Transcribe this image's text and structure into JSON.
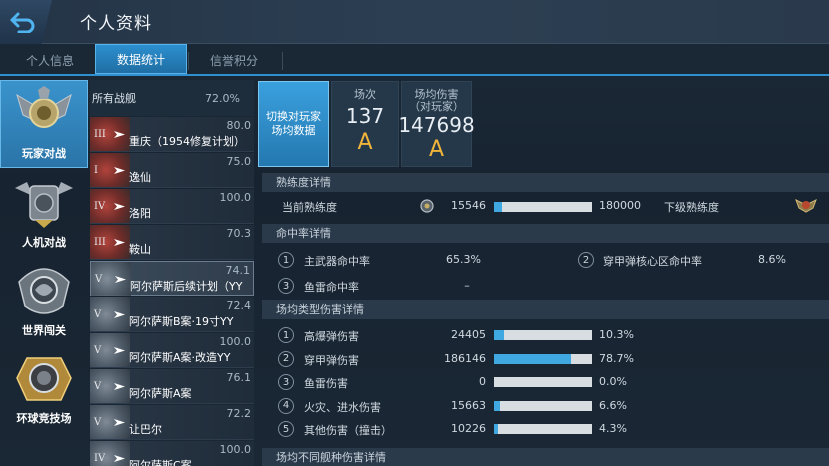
{
  "header": {
    "title": "个人资料"
  },
  "tabs": [
    "个人信息",
    "数据统计",
    "信誉积分"
  ],
  "modes": [
    {
      "label": "玩家对战"
    },
    {
      "label": "人机对战"
    },
    {
      "label": "世界闯关"
    },
    {
      "label": "环球竞技场"
    }
  ],
  "ships": {
    "all_label": "所有战舰",
    "all_pct": "72.0%",
    "items": [
      {
        "tier": "III",
        "pct": "80.0",
        "name": "重庆（1954修复计划）"
      },
      {
        "tier": "I",
        "pct": "75.0",
        "name": "逸仙"
      },
      {
        "tier": "IV",
        "pct": "100.0",
        "name": "洛阳"
      },
      {
        "tier": "III",
        "pct": "70.3",
        "name": "鞍山"
      },
      {
        "tier": "V",
        "pct": "74.1",
        "name": "阿尔萨斯后续计划（YY"
      },
      {
        "tier": "V",
        "pct": "72.4",
        "name": "阿尔萨斯B案·19寸YY"
      },
      {
        "tier": "V",
        "pct": "100.0",
        "name": "阿尔萨斯A案·改造YY"
      },
      {
        "tier": "V",
        "pct": "76.1",
        "name": "阿尔萨斯A案"
      },
      {
        "tier": "V",
        "pct": "72.2",
        "name": "让巴尔"
      },
      {
        "tier": "IV",
        "pct": "100.0",
        "name": "阿尔萨斯C案"
      }
    ]
  },
  "summary": {
    "switch_label": "切换对玩家场均数据",
    "battles_label": "场次",
    "battles_value": "137",
    "battles_grade": "A",
    "damage_label": "场均伤害（对玩家）",
    "damage_value": "147698",
    "damage_grade": "A"
  },
  "proficiency": {
    "section": "熟练度详情",
    "current_label": "当前熟练度",
    "current_value": "15546",
    "max_value": "180000",
    "next_label": "下级熟练度",
    "fill": 0.086
  },
  "hit_rate": {
    "section": "命中率详情",
    "items": [
      {
        "n": "1",
        "label": "主武器命中率",
        "value": "65.3%"
      },
      {
        "n": "2",
        "label": "穿甲弹核心区命中率",
        "value": "8.6%"
      },
      {
        "n": "3",
        "label": "鱼雷命中率",
        "value": "–"
      }
    ]
  },
  "damage_types": {
    "section": "场均类型伤害详情",
    "items": [
      {
        "n": "1",
        "label": "高爆弹伤害",
        "value": "24405",
        "pct": "10.3%",
        "fill": 0.103
      },
      {
        "n": "2",
        "label": "穿甲弹伤害",
        "value": "186146",
        "pct": "78.7%",
        "fill": 0.787
      },
      {
        "n": "3",
        "label": "鱼雷伤害",
        "value": "0",
        "pct": "0.0%",
        "fill": 0.0
      },
      {
        "n": "4",
        "label": "火灾、进水伤害",
        "value": "15663",
        "pct": "6.6%",
        "fill": 0.066
      },
      {
        "n": "5",
        "label": "其他伤害（撞击）",
        "value": "10226",
        "pct": "4.3%",
        "fill": 0.043
      }
    ]
  },
  "by_ship_type": {
    "section": "场均不同舰种伤害详情"
  },
  "colors": {
    "accent": "#2c8fcf",
    "bar": "#3fa8e0",
    "grade": "#f1b43a"
  }
}
